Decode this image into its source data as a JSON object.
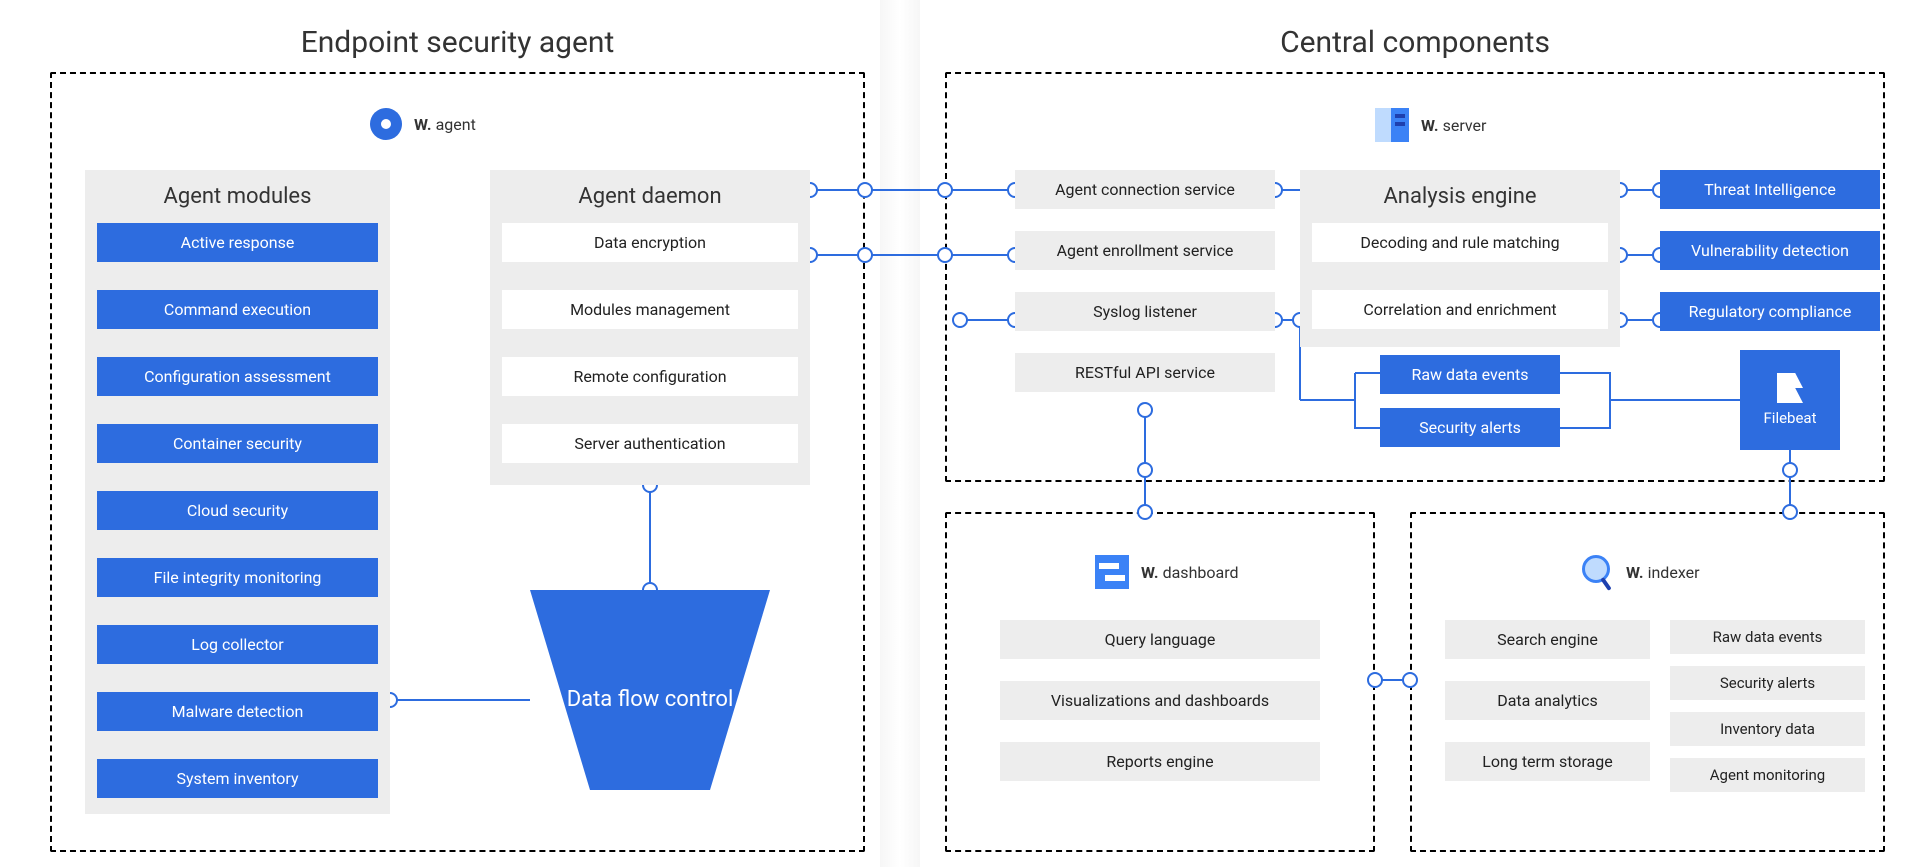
{
  "left": {
    "title": "Endpoint security agent",
    "brand_prefix": "W.",
    "brand_name": "agent",
    "modules_title": "Agent modules",
    "modules": [
      "Active response",
      "Command execution",
      "Configuration assessment",
      "Container security",
      "Cloud security",
      "File integrity monitoring",
      "Log collector",
      "Malware detection",
      "System inventory"
    ],
    "daemon_title": "Agent daemon",
    "daemon": [
      "Data encryption",
      "Modules management",
      "Remote configuration",
      "Server authentication"
    ],
    "funnel_label": "Data flow control"
  },
  "right": {
    "title": "Central components",
    "server_brand_prefix": "W.",
    "server_brand_name": "server",
    "services": [
      "Agent connection service",
      "Agent enrollment service",
      "Syslog listener",
      "RESTful API service"
    ],
    "analysis_title": "Analysis engine",
    "analysis": [
      "Decoding and rule matching",
      "Correlation and enrichment"
    ],
    "data_events": [
      "Raw data events",
      "Security alerts"
    ],
    "filebeat_label": "Filebeat",
    "side_features": [
      "Threat Intelligence",
      "Vulnerability detection",
      "Regulatory compliance"
    ],
    "dashboard_brand_prefix": "W.",
    "dashboard_brand_name": "dashboard",
    "dashboard_items": [
      "Query language",
      "Visualizations and dashboards",
      "Reports engine"
    ],
    "indexer_brand_prefix": "W.",
    "indexer_brand_name": "indexer",
    "indexer_left": [
      "Search engine",
      "Data analytics",
      "Long term storage"
    ],
    "indexer_right": [
      "Raw data events",
      "Security alerts",
      "Inventory data",
      "Agent monitoring"
    ]
  }
}
